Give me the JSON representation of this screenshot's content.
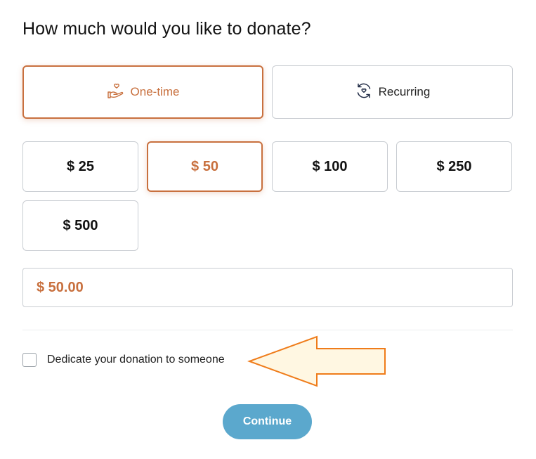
{
  "heading": "How much would you like to donate?",
  "frequency": {
    "one_time_label": "One-time",
    "recurring_label": "Recurring"
  },
  "amounts": [
    "$ 25",
    "$ 50",
    "$ 100",
    "$ 250",
    "$ 500"
  ],
  "selected_amount": "$ 50",
  "amount_input": {
    "value": "$ 50.00"
  },
  "dedicate": {
    "label": "Dedicate your donation to someone",
    "checked": false
  },
  "continue_label": "Continue",
  "colors": {
    "accent": "#c8703e",
    "button": "#5ba8cd",
    "arrow_fill": "#fff7e2",
    "arrow_stroke": "#ef7c1a"
  }
}
